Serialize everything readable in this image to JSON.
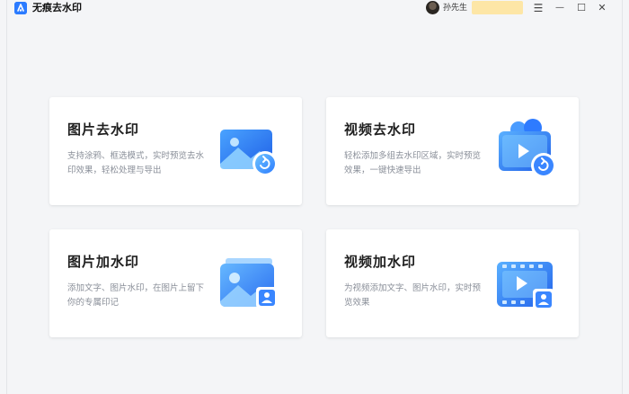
{
  "app": {
    "title": "无痕去水印",
    "username": "孙先生"
  },
  "window_controls": {
    "menu": "☰",
    "minimize": "—",
    "maximize": "☐",
    "close": "✕"
  },
  "cards": [
    {
      "title": "图片去水印",
      "desc": "支持涂鸦、框选模式，实时预览去水印效果，轻松处理与导出",
      "icon": "image-remove-watermark-icon"
    },
    {
      "title": "视频去水印",
      "desc": "轻松添加多组去水印区域，实时预览效果，一键快速导出",
      "icon": "video-remove-watermark-icon"
    },
    {
      "title": "图片加水印",
      "desc": "添加文字、图片水印，在图片上留下你的专属印记",
      "icon": "image-add-watermark-icon"
    },
    {
      "title": "视频加水印",
      "desc": "为视频添加文字、图片水印，实时预览效果",
      "icon": "video-add-watermark-icon"
    }
  ],
  "colors": {
    "accent": "#2b7bff",
    "card_bg": "#ffffff",
    "page_bg": "#f4f5f7",
    "vip_badge": "#fde6a6"
  }
}
